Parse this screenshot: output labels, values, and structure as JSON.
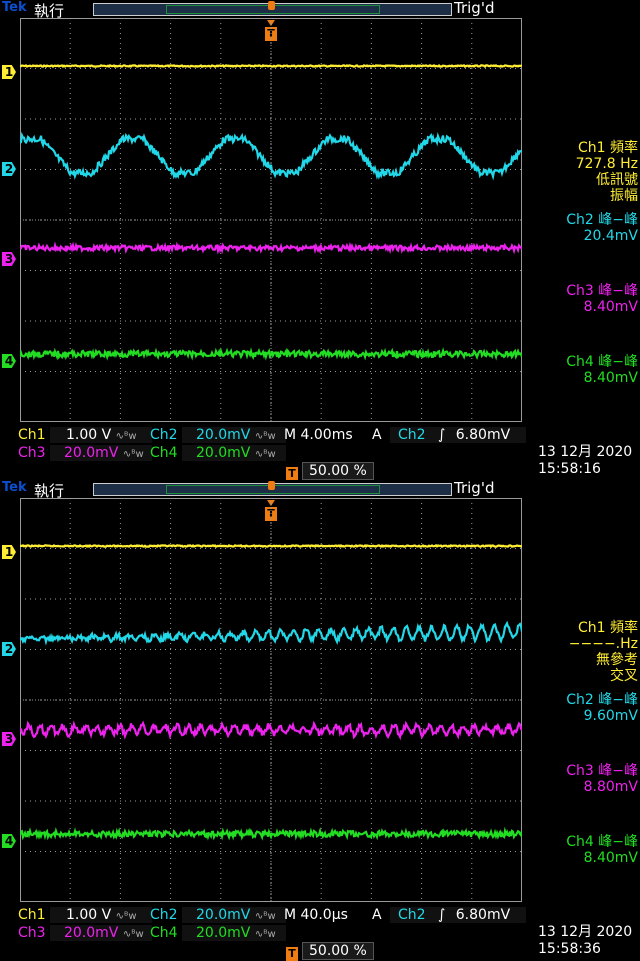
{
  "colors": {
    "ch1": "#ffee33",
    "ch2": "#22d8e8",
    "ch3": "#ee22ee",
    "ch4": "#22dd22",
    "trigger": "#f07b10",
    "grid": "#9a9a9a"
  },
  "screens": [
    {
      "brand": "Tek",
      "mode": "執行",
      "trig_status": "Trig'd",
      "trigger_marker": "T",
      "marker_labels": [
        "1",
        "2",
        "3",
        "4"
      ],
      "readouts": {
        "ch1": {
          "label": "Ch1 頻率",
          "value": "727.8 Hz",
          "note1": "低訊號",
          "note2": "振幅"
        },
        "ch2": {
          "label": "Ch2 峰−峰",
          "value": "20.4mV"
        },
        "ch3": {
          "label": "Ch3 峰−峰",
          "value": "8.40mV"
        },
        "ch4": {
          "label": "Ch4 峰−峰",
          "value": "8.40mV"
        }
      },
      "settings": {
        "ch1_label": "Ch1",
        "ch1_scale": "1.00 V",
        "ch2_label": "Ch2",
        "ch2_scale": "20.0mV",
        "ch3_label": "Ch3",
        "ch3_scale": "20.0mV",
        "ch4_label": "Ch4",
        "ch4_scale": "20.0mV",
        "timebase": "M 4.00ms",
        "acq": "A",
        "trig_source": "Ch2",
        "trig_slope": "∫",
        "trig_level": "6.80mV",
        "bw_icon": "∿ᴮw"
      },
      "trigger_position": "50.00 %",
      "date": "13 12月 2020",
      "time": "15:58:16",
      "wave": "triangle"
    },
    {
      "brand": "Tek",
      "mode": "執行",
      "trig_status": "Trig'd",
      "trigger_marker": "T",
      "marker_labels": [
        "1",
        "2",
        "3",
        "4"
      ],
      "readouts": {
        "ch1": {
          "label": "Ch1 頻率",
          "value": "−−−−.Hz",
          "note1": "無參考",
          "note2": "交叉"
        },
        "ch2": {
          "label": "Ch2 峰−峰",
          "value": "9.60mV"
        },
        "ch3": {
          "label": "Ch3 峰−峰",
          "value": "8.80mV"
        },
        "ch4": {
          "label": "Ch4 峰−峰",
          "value": "8.40mV"
        }
      },
      "settings": {
        "ch1_label": "Ch1",
        "ch1_scale": "1.00 V",
        "ch2_label": "Ch2",
        "ch2_scale": "20.0mV",
        "ch3_label": "Ch3",
        "ch3_scale": "20.0mV",
        "ch4_label": "Ch4",
        "ch4_scale": "20.0mV",
        "timebase": "M 40.0µs",
        "acq": "A",
        "trig_source": "Ch2",
        "trig_slope": "∫",
        "trig_level": "6.80mV",
        "bw_icon": "∿ᴮw"
      },
      "trigger_position": "50.00 %",
      "date": "13 12月 2020",
      "time": "15:58:36",
      "wave": "ripple"
    }
  ]
}
